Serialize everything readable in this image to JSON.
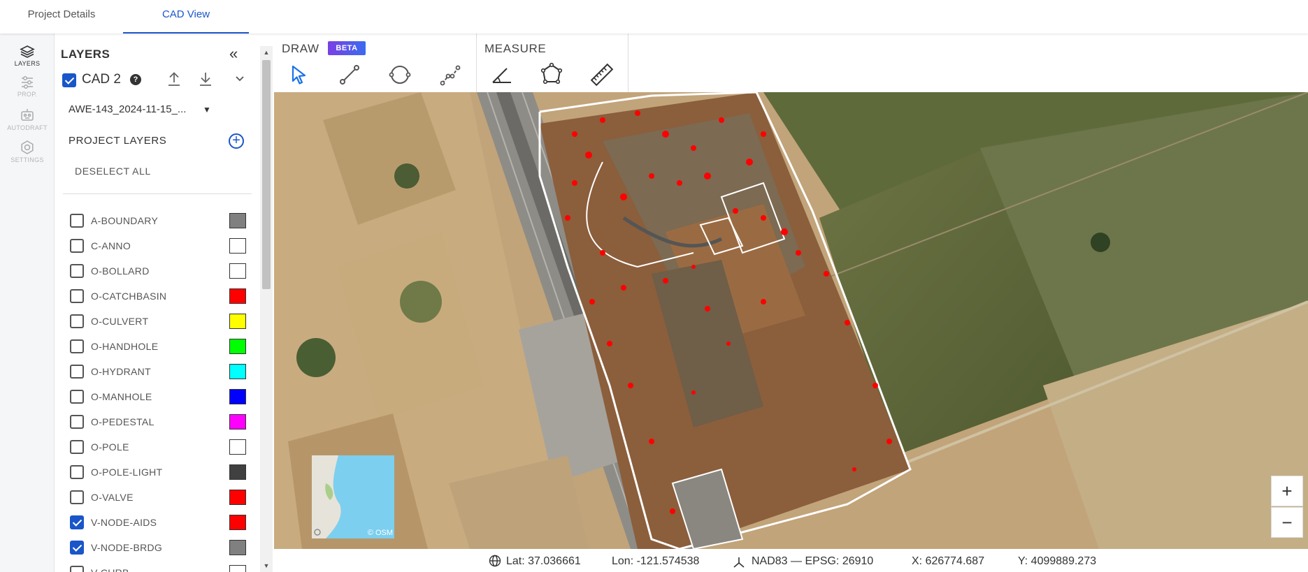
{
  "tabs": [
    {
      "label": "Project Details",
      "active": false
    },
    {
      "label": "CAD View",
      "active": true
    }
  ],
  "rail": [
    {
      "label": "LAYERS",
      "icon": "layers-icon",
      "active": true
    },
    {
      "label": "PROP.",
      "icon": "sliders-icon",
      "active": false
    },
    {
      "label": "AUTODRAFT",
      "icon": "robot-icon",
      "active": false
    },
    {
      "label": "SETTINGS",
      "icon": "gear-icon",
      "active": false
    }
  ],
  "layers_panel": {
    "title": "LAYERS",
    "cad": {
      "name": "CAD 2",
      "checked": true
    },
    "file": "AWE-143_2024-11-15_...",
    "project_layers_label": "PROJECT LAYERS",
    "deselect_all": "DESELECT ALL",
    "items": [
      {
        "name": "A-BOUNDARY",
        "checked": false,
        "color": "#808080"
      },
      {
        "name": "C-ANNO",
        "checked": false,
        "color": "#ffffff"
      },
      {
        "name": "O-BOLLARD",
        "checked": false,
        "color": "#ffffff"
      },
      {
        "name": "O-CATCHBASIN",
        "checked": false,
        "color": "#ff0000"
      },
      {
        "name": "O-CULVERT",
        "checked": false,
        "color": "#ffff00"
      },
      {
        "name": "O-HANDHOLE",
        "checked": false,
        "color": "#00ff00"
      },
      {
        "name": "O-HYDRANT",
        "checked": false,
        "color": "#00ffff"
      },
      {
        "name": "O-MANHOLE",
        "checked": false,
        "color": "#0000ff"
      },
      {
        "name": "O-PEDESTAL",
        "checked": false,
        "color": "#ff00ff"
      },
      {
        "name": "O-POLE",
        "checked": false,
        "color": "#ffffff"
      },
      {
        "name": "O-POLE-LIGHT",
        "checked": false,
        "color": "#404040"
      },
      {
        "name": "O-VALVE",
        "checked": false,
        "color": "#ff0000"
      },
      {
        "name": "V-NODE-AIDS",
        "checked": true,
        "color": "#ff0000"
      },
      {
        "name": "V-NODE-BRDG",
        "checked": true,
        "color": "#808080"
      },
      {
        "name": "V-CURB",
        "checked": false,
        "color": "#ffffff"
      }
    ]
  },
  "toolbar": {
    "draw_label": "DRAW",
    "beta_label": "BETA",
    "measure_label": "MEASURE",
    "draw_tools": [
      "select-tool",
      "line-tool",
      "circle-tool",
      "polyline-tool"
    ],
    "measure_tools": [
      "angle-tool",
      "area-tool",
      "ruler-tool"
    ]
  },
  "map": {
    "attribution": "© OSM",
    "zoom_in": "+",
    "zoom_out": "−"
  },
  "status": {
    "lat": "Lat: 37.036661",
    "lon": "Lon: -121.574538",
    "crs": "NAD83 — EPSG: 26910",
    "x": "X: 626774.687",
    "y": "Y: 4099889.273"
  }
}
